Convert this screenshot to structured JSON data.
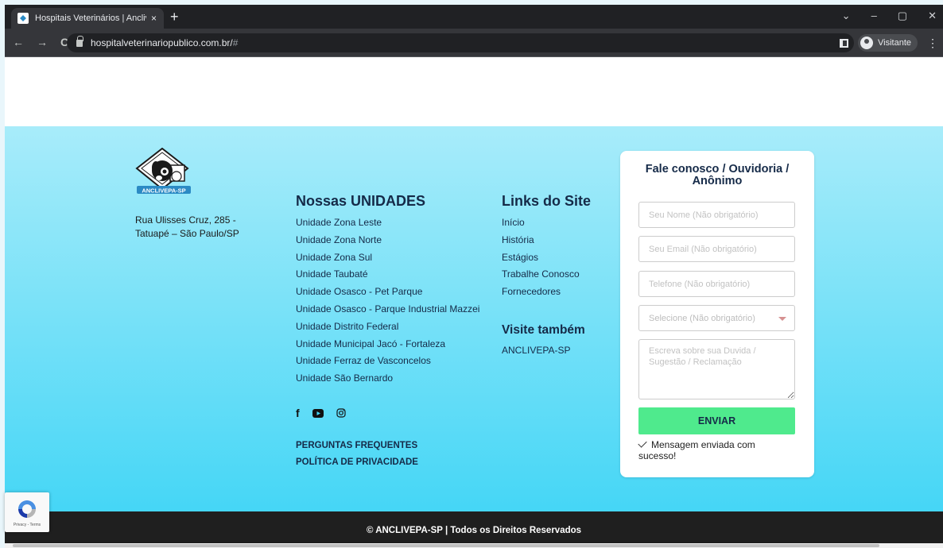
{
  "browser": {
    "tab_title": "Hospitais Veterinários | Anclivepa",
    "tab_close": "×",
    "new_tab": "+",
    "url_main": "hospitalveterinariopublico.com.br/",
    "url_hash": "#",
    "profile_label": "Visitante",
    "nav": {
      "back": "←",
      "forward": "→",
      "reload": "C"
    },
    "window": {
      "dropdown": "⌄",
      "minimize": "–",
      "restore": "▢",
      "close": "✕"
    },
    "kebab": "⋮"
  },
  "brand": {
    "logo_text": "ANCLIVEPA-SP",
    "logo_accent": "#2b8ac4"
  },
  "address": {
    "line1": "Rua Ulisses Cruz, 285 -",
    "line2": "Tatuapé – São Paulo/SP"
  },
  "unidades": {
    "title": "Nossas UNIDADES",
    "items": [
      "Unidade Zona Leste",
      "Unidade Zona Norte",
      "Unidade Zona Sul",
      "Unidade Taubaté",
      "Unidade Osasco - Pet Parque",
      "Unidade Osasco - Parque Industrial Mazzei",
      "Unidade Distrito Federal",
      "Unidade Municipal Jacó - Fortaleza",
      "Unidade Ferraz de Vasconcelos",
      "Unidade São Bernardo"
    ]
  },
  "links": {
    "title": "Links do Site",
    "items": [
      "Início",
      "História",
      "Estágios",
      "Trabalhe Conosco",
      "Fornecedores"
    ]
  },
  "visite": {
    "title": "Visite também",
    "items": [
      "ANCLIVEPA-SP"
    ]
  },
  "social": {
    "facebook": "f"
  },
  "extra_links": {
    "faq": "PERGUNTAS FREQUENTES",
    "privacy": "POLÍTICA DE PRIVACIDADE"
  },
  "form": {
    "title_line1": "Fale conosco / Ouvidoria /",
    "title_line2": "Anônimo",
    "name_placeholder": "Seu Nome (Não obrigatório)",
    "email_placeholder": "Seu Email (Não obrigatório)",
    "phone_placeholder": "Telefone (Não obrigatório)",
    "select_value": "Selecione (Não obrigatório)",
    "message_placeholder": "Escreva sobre sua Duvida / Sugestão / Reclamação",
    "submit_label": "ENVIAR",
    "success_message": "Mensagem enviada com sucesso!",
    "submit_color": "#4fea8d"
  },
  "footer": {
    "copyright": "© ANCLIVEPA-SP | Todos os Direitos Reservados"
  },
  "recaptcha": {
    "label": "Privacy - Terms"
  },
  "colors": {
    "gradient_top": "#a8ecfa",
    "gradient_bottom": "#45d6f6",
    "heading": "#152a48",
    "footer_bar": "#1f1f1f"
  }
}
